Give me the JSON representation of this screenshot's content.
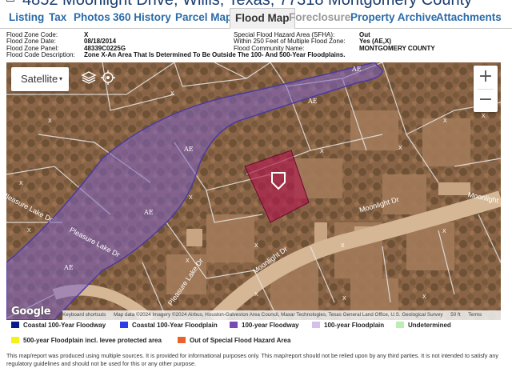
{
  "header": {
    "title": "4852 Moonlight Drive, Willis, Texas, 77318 Montgomery County"
  },
  "tabs": [
    {
      "label": "Listing"
    },
    {
      "label": "Tax"
    },
    {
      "label": "Photos"
    },
    {
      "label": "360 History"
    },
    {
      "label": "Parcel Map"
    },
    {
      "label": "Flood Map"
    },
    {
      "label": "Foreclosure"
    },
    {
      "label": "Property Archive"
    },
    {
      "label": "Attachments"
    }
  ],
  "flood_info": {
    "zone_code_label": "Flood Zone Code:",
    "zone_code": "X",
    "zone_date_label": "Flood Zone Date:",
    "zone_date": "08/18/2014",
    "zone_panel_label": "Flood Zone Panel:",
    "zone_panel": "48339C0225G",
    "code_desc_label": "Flood Code Description:",
    "code_desc": "Zone X-An Area That Is Determined To Be Outside The 100- And 500-Year Floodplains.",
    "sfha_label": "Special Flood Hazard Area (SFHA):",
    "sfha": "Out",
    "within_label": "Within 250 Feet of Multiple Flood Zone:",
    "within": "Yes (AE,X)",
    "community_label": "Flood Community Name:",
    "community": "MONTGOMERY COUNTY"
  },
  "map": {
    "map_type": "Satellite",
    "zoom_in": "+",
    "zoom_out": "−",
    "google": "Google",
    "attribution": [
      "Keyboard shortcuts",
      "Map data ©2024 Imagery ©2024 Airbus, Houston-Galveston Area Council, Maxar Technologies, Texas General Land Office, U.S. Geological Survey",
      "50 ft",
      "Terms"
    ],
    "street_labels": [
      "Pleasure Lake Dr",
      "Pleasure Lake Dr",
      "Moonlight Dr",
      "Moonlight Dr",
      "Moonlight Dr",
      "Pleasure Lake Dr"
    ],
    "zone_labels": [
      "AE",
      "AE",
      "AE",
      "AE",
      "AE"
    ],
    "x_labels": [
      "X",
      "X",
      "X",
      "X",
      "X",
      "X",
      "X",
      "X",
      "X",
      "X",
      "X",
      "X",
      "X",
      "X",
      "X",
      "X"
    ],
    "icons": [
      "layers-icon",
      "location-icon",
      "map-marker-icon"
    ]
  },
  "legend": [
    {
      "label": "Coastal 100-Year Floodway",
      "color": "#0a1a8c"
    },
    {
      "label": "Coastal 100-Year Floodplain",
      "color": "#2a3ee8"
    },
    {
      "label": "100-year Floodway",
      "color": "#7b4bb3"
    },
    {
      "label": "100-year Floodplain",
      "color": "#d6bfe8"
    },
    {
      "label": "Undetermined",
      "color": "#b9f0b0"
    },
    {
      "label": "500-year Floodplain incl. levee protected area",
      "color": "#f5f21a"
    },
    {
      "label": "Out of Special Flood Hazard Area",
      "color": "#e8622a"
    }
  ],
  "disclaimer": "This map/report was produced using multiple sources. It is provided for informational purposes only. This map/report should not be relied upon by any third parties. It is not intended to satisfy any regulatory guidelines and should not be used for this or any other purpose."
}
